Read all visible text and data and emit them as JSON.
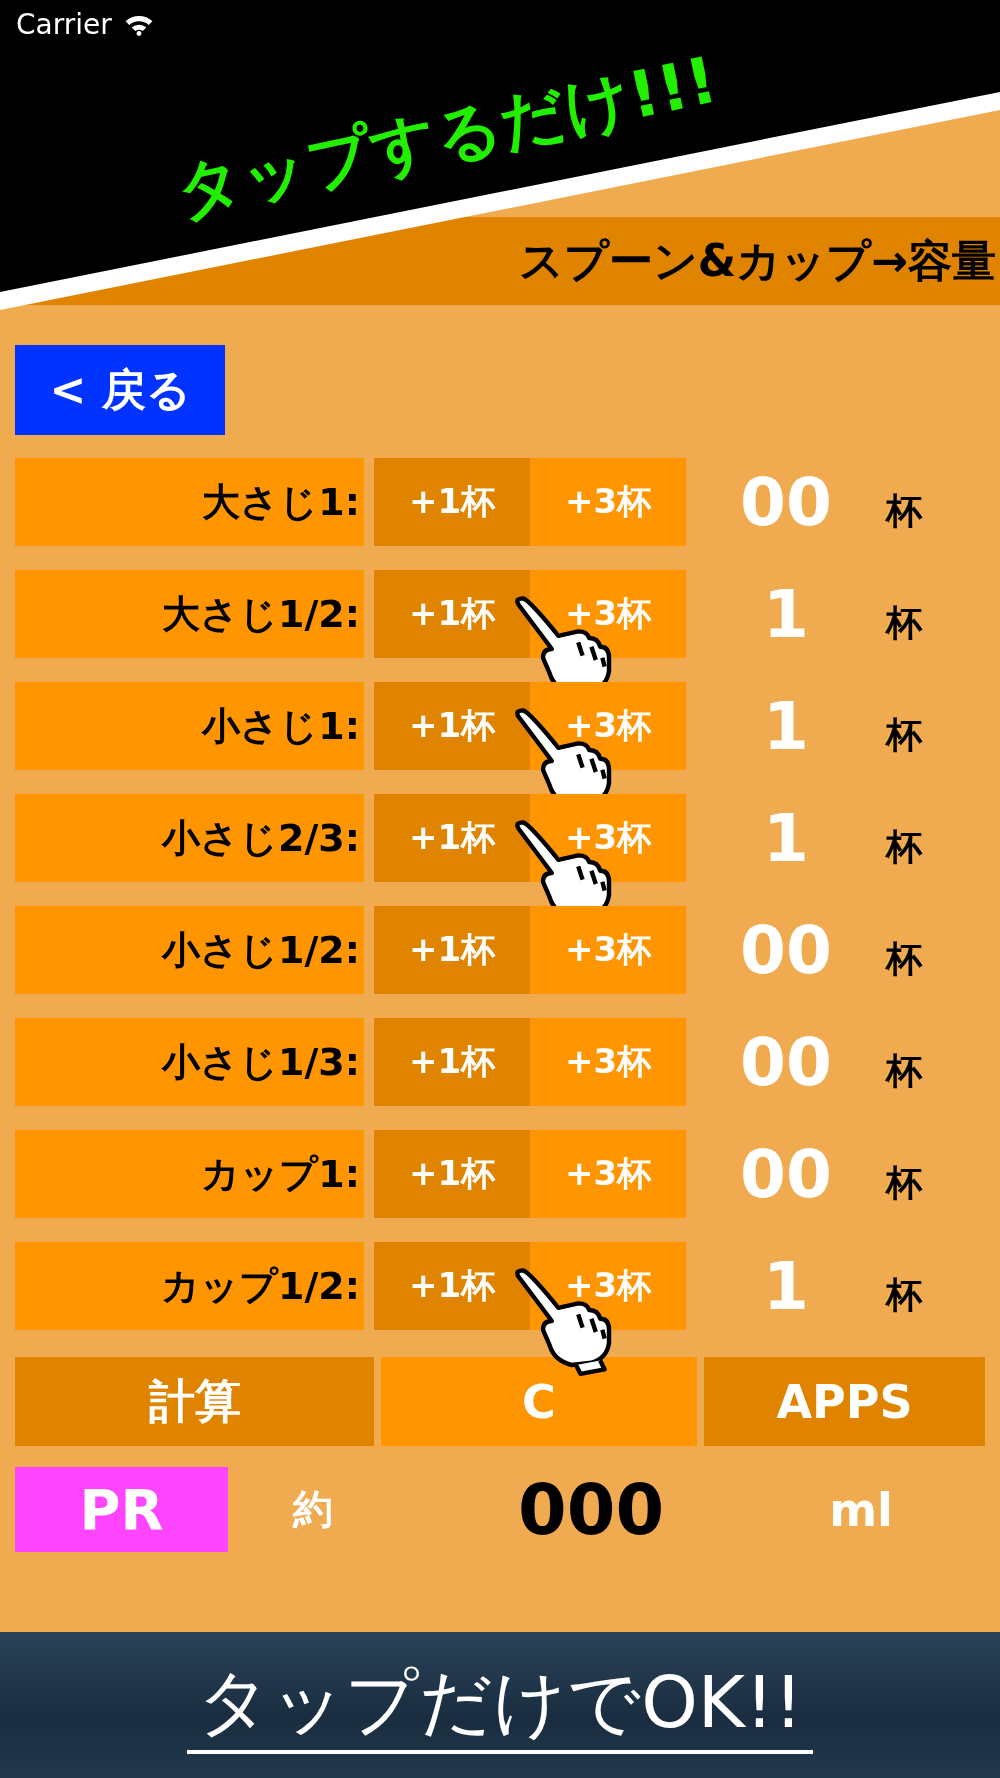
{
  "status_bar": {
    "carrier": "Carrier"
  },
  "promo_banner": {
    "text": "タップするだけ!!!"
  },
  "header": {
    "title": "スプーン&カップ→容量"
  },
  "back_button": {
    "label": "< 戻る"
  },
  "rows": [
    {
      "label": "大さじ1:",
      "add_one": "+1杯",
      "add_three": "+3杯",
      "count": "00",
      "unit": "杯",
      "pointer": false
    },
    {
      "label": "大さじ1/2:",
      "add_one": "+1杯",
      "add_three": "+3杯",
      "count": "1",
      "unit": "杯",
      "pointer": true
    },
    {
      "label": "小さじ1:",
      "add_one": "+1杯",
      "add_three": "+3杯",
      "count": "1",
      "unit": "杯",
      "pointer": true
    },
    {
      "label": "小さじ2/3:",
      "add_one": "+1杯",
      "add_three": "+3杯",
      "count": "1",
      "unit": "杯",
      "pointer": true
    },
    {
      "label": "小さじ1/2:",
      "add_one": "+1杯",
      "add_three": "+3杯",
      "count": "00",
      "unit": "杯",
      "pointer": false
    },
    {
      "label": "小さじ1/3:",
      "add_one": "+1杯",
      "add_three": "+3杯",
      "count": "00",
      "unit": "杯",
      "pointer": false
    },
    {
      "label": "カップ1:",
      "add_one": "+1杯",
      "add_three": "+3杯",
      "count": "00",
      "unit": "杯",
      "pointer": false
    },
    {
      "label": "カップ1/2:",
      "add_one": "+1杯",
      "add_three": "+3杯",
      "count": "1",
      "unit": "杯",
      "pointer": true
    }
  ],
  "actions": [
    {
      "label": "計算",
      "kind": "dark"
    },
    {
      "label": "C",
      "kind": "light"
    },
    {
      "label": "APPS",
      "kind": "dark"
    }
  ],
  "result": {
    "pr": "PR",
    "prefix": "約",
    "value": "000",
    "unit": "ml"
  },
  "bottom_banner": {
    "text": "タップだけでOK!!"
  }
}
